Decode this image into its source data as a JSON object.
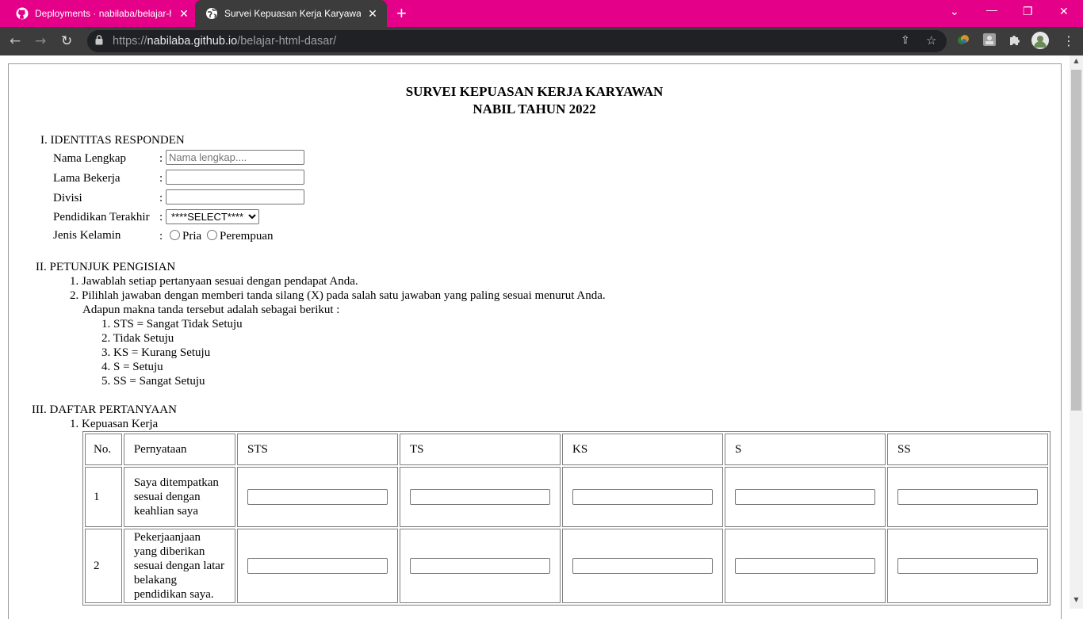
{
  "browser": {
    "tabs": [
      {
        "title": "Deployments · nabilaba/belajar-h",
        "active": false,
        "icon": "github-icon"
      },
      {
        "title": "Survei Kepuasan Kerja Karyawan",
        "active": true,
        "icon": "globe-icon"
      }
    ],
    "url_scheme": "https://",
    "url_host": "nabilaba.github.io",
    "url_path": "/belajar-html-dasar/",
    "colors": {
      "tabbar": "#e5008a",
      "toolbar": "#3c3c3c"
    }
  },
  "page": {
    "title_line1": "SURVEI KEPUASAN KERJA KARYAWAN",
    "title_line2": "NABIL TAHUN 2022",
    "section1": {
      "heading": "I. IDENTITAS RESPONDEN",
      "fields": {
        "nama": {
          "label": "Nama Lengkap",
          "colon": ":",
          "placeholder": "Nama lengkap....",
          "value": ""
        },
        "lama": {
          "label": "Lama Bekerja",
          "colon": ":",
          "value": ""
        },
        "divisi": {
          "label": "Divisi",
          "colon": ":",
          "value": ""
        },
        "pendidikan": {
          "label": "Pendidikan Terakhir",
          "colon": ":",
          "selected": "****SELECT****"
        },
        "kelamin": {
          "label": "Jenis Kelamin",
          "colon": ":",
          "option_a": "Pria",
          "option_b": "Perempuan"
        }
      }
    },
    "section2": {
      "heading": "II. PETUNJUK PENGISIAN",
      "items": [
        "1. Jawablah setiap pertanyaan sesuai dengan pendapat Anda.",
        "2. Pilihlah jawaban dengan memberi tanda silang (X) pada salah satu jawaban yang paling sesuai menurut Anda."
      ],
      "note": "Adapun makna tanda tersebut adalah sebagai berikut :",
      "scale": [
        "1. STS = Sangat Tidak Setuju",
        "2. Tidak Setuju",
        "3. KS = Kurang Setuju",
        "4. S = Setuju",
        "5. SS = Sangat Setuju"
      ]
    },
    "section3": {
      "heading": "III. DAFTAR PERTANYAAN",
      "subheading": "1. Kepuasan Kerja",
      "table": {
        "headers": [
          "No.",
          "Pernyataan",
          "STS",
          "TS",
          "KS",
          "S",
          "SS"
        ],
        "rows": [
          {
            "no": "1",
            "text": "Saya ditempatkan sesuai dengan keahlian saya"
          },
          {
            "no": "2",
            "text": "Pekerjaanjaan yang diberikan sesuai dengan latar belakang pendidikan saya."
          }
        ]
      }
    }
  }
}
